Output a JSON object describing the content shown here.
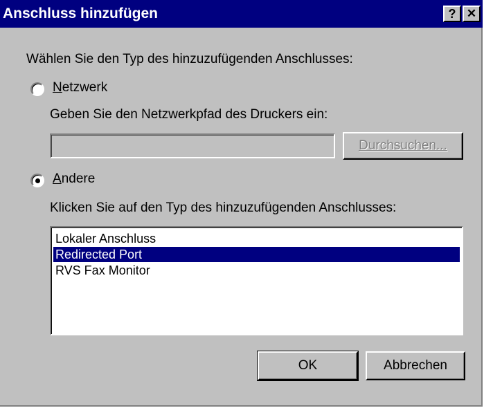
{
  "window": {
    "title": "Anschluss hinzufügen",
    "help_label": "?",
    "close_label": "✕"
  },
  "prompt": "Wählen Sie den Typ des hinzuzufügenden Anschlusses:",
  "network_option": {
    "label_prefix": "",
    "label_mnemonic": "N",
    "label_rest": "etzwerk",
    "selected": false,
    "path_label": "Geben Sie den Netzwerkpfad des Druckers ein:",
    "path_value": "",
    "browse_label": "Durchsuchen..."
  },
  "other_option": {
    "label_mnemonic": "A",
    "label_rest": "ndere",
    "selected": true,
    "list_label": "Klicken Sie auf den Typ des hinzuzufügenden Anschlusses:",
    "items": [
      "Lokaler Anschluss",
      "Redirected Port",
      "RVS Fax Monitor"
    ],
    "selected_index": 1
  },
  "buttons": {
    "ok": "OK",
    "cancel": "Abbrechen"
  },
  "colors": {
    "titlebar": "#000080",
    "face": "#c0c0c0",
    "selection": "#000080"
  }
}
